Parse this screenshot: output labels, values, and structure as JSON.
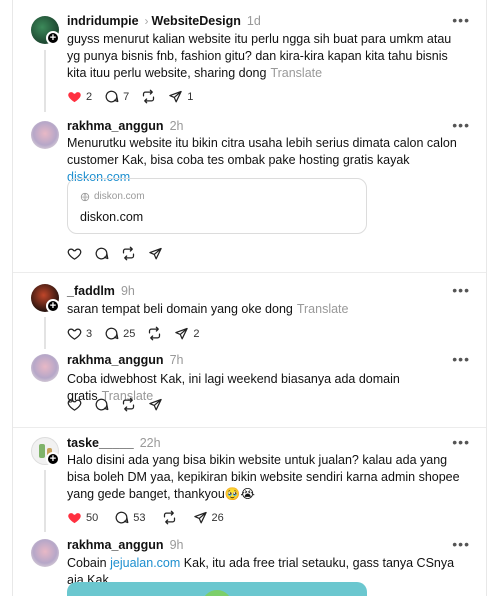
{
  "posts": [
    {
      "username": "indridumpie",
      "topic": "WebsiteDesign",
      "time": "1d",
      "text": "guyss menurut kalian website itu perlu ngga sih buat para umkm atau yg punya bisnis fnb, fashion gitu? dan kira-kira kapan kita tahu bisnis kita ituu perlu website, sharing dong",
      "translate": "Translate",
      "likes": "2",
      "replies": "7",
      "reposts": "",
      "shares": "1",
      "liked": true
    },
    {
      "username": "rakhma_anggun",
      "time": "2h",
      "text": "Menurutku website itu bikin citra usaha lebih serius dimata calon calon customer Kak, bisa coba tes ombak pake hosting gratis kayak",
      "link": "diskon.com",
      "card": {
        "domain": "diskon.com",
        "title": "diskon.com"
      }
    },
    {
      "username": "_faddlm",
      "time": "9h",
      "text": "saran tempat beli domain yang oke dong",
      "translate": "Translate",
      "likes": "3",
      "replies": "25",
      "shares": "2"
    },
    {
      "username": "rakhma_anggun",
      "time": "7h",
      "text": "Coba idwebhost Kak, ini lagi weekend biasanya ada domain gratis",
      "translate": "Translate"
    },
    {
      "username": "taske_____",
      "time": "22h",
      "text": "Halo disini ada yang bisa bikin website untuk jualan? kalau ada yang bisa boleh DM yaa, kepikiran bikin website sendiri karna admin shopee yang gede banget, thankyou🥹😭",
      "likes": "50",
      "replies": "53",
      "shares": "26",
      "liked": true
    },
    {
      "username": "rakhma_anggun",
      "time": "9h",
      "text_before": "Cobain",
      "link": "jejualan.com",
      "text_after": "Kak, itu ada free trial setauku, gass tanya CSnya aja Kak"
    }
  ],
  "icons": {
    "like": "heart-icon",
    "reply": "comment-icon",
    "repost": "repost-icon",
    "share": "share-icon",
    "more": "more-icon",
    "globe": "globe-icon"
  },
  "colors": {
    "liked": "#ff3040",
    "link": "#1d8fcf",
    "muted": "#999999"
  },
  "more_label": "•••"
}
